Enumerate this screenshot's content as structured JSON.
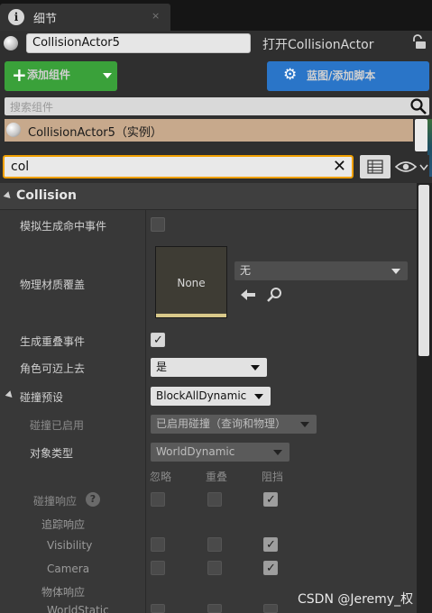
{
  "tab": {
    "title": "细节",
    "close": "×"
  },
  "actor": {
    "name": "CollisionActor5",
    "open_link": "打开CollisionActor"
  },
  "toolbar": {
    "add_component": "添加组件",
    "add_plus": "+",
    "blueprint": "蓝图/添加脚本"
  },
  "components": {
    "search_placeholder": "搜索组件",
    "items": [
      {
        "label": "CollisionActor5（实例）"
      }
    ]
  },
  "filter": {
    "value": "col",
    "clear": "✕"
  },
  "category": {
    "label": "Collision"
  },
  "properties": {
    "sim_hit": {
      "label": "模拟生成命中事件",
      "checked": false
    },
    "phys_mat": {
      "label": "物理材质覆盖",
      "thumb": "None",
      "value": "无"
    },
    "gen_overlap": {
      "label": "生成重叠事件",
      "checked": true
    },
    "step_up": {
      "label": "角色可迈上去",
      "value": "是"
    },
    "preset": {
      "label": "碰撞预设",
      "value": "BlockAllDynamic"
    },
    "enabled": {
      "label": "碰撞已启用",
      "value": "已启用碰撞（查询和物理）"
    },
    "obj_type": {
      "label": "对象类型",
      "value": "WorldDynamic"
    },
    "col_headers": [
      "忽略",
      "重叠",
      "阻挡"
    ],
    "response": {
      "label": "碰撞响应",
      "help": "?"
    },
    "trace": {
      "label": "追踪响应"
    },
    "visibility": {
      "label": "Visibility"
    },
    "camera": {
      "label": "Camera"
    },
    "object": {
      "label": "物体响应"
    },
    "worldstatic": {
      "label": "WorldStatic"
    }
  },
  "watermark": "CSDN @Jeremy_权",
  "colors": {
    "add_green": "#3aa13a",
    "blueprint_blue": "#2a75c8",
    "filter_border": "#f0a000",
    "selected_component": "#c7a98c"
  },
  "icons": [
    "info-icon",
    "lock-icon",
    "gear-icon",
    "search-icon",
    "grid-icon",
    "eye-icon",
    "chevron-down-icon",
    "back-arrow-icon",
    "help-icon"
  ]
}
